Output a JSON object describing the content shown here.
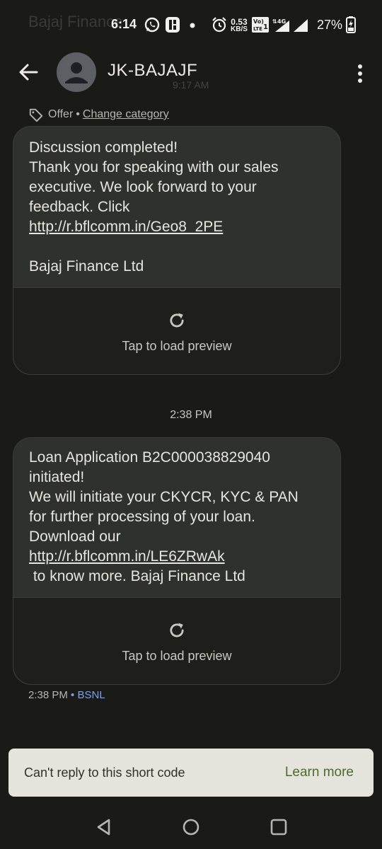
{
  "statusbar": {
    "ghost_title": "Bajaj Finance",
    "time": "6:14",
    "netspeed_value": "0.53",
    "netspeed_unit": "KB/S",
    "network": "4G",
    "battery": "27%"
  },
  "header": {
    "contact_name": "JK-BAJAJF",
    "ghost_time": "9:17 AM"
  },
  "category": {
    "label": "Offer",
    "separator": "•",
    "change_link": "Change category"
  },
  "messages": [
    {
      "line1": "Discussion completed!",
      "line2": "Thank you for speaking with our sales",
      "line3": "executive. We look forward to your",
      "line4": "feedback. Click",
      "link": "http://r.bflcomm.in/Geo8_2PE",
      "signature": "Bajaj Finance Ltd",
      "preview_label": "Tap to load preview"
    },
    {
      "line1": "Loan Application B2C000038829040",
      "line2": "initiated!",
      "line3": "We will initiate your CKYCR, KYC & PAN",
      "line4": "for further processing of your loan.",
      "line5": "Download our",
      "link": "http://r.bflcomm.in/LE6ZRwAk",
      "tail": " to know more. Bajaj Finance Ltd",
      "preview_label": "Tap to load preview"
    }
  ],
  "timestamp_divider": "2:38 PM",
  "meta": {
    "time": "2:38 PM",
    "separator": "•",
    "carrier": "BSNL"
  },
  "snackbar": {
    "message": "Can't reply to this short code",
    "action": "Learn more"
  },
  "colors": {
    "background": "#1a1b17",
    "bubble": "#2f312c",
    "accent_action": "#4c6b2a",
    "carrier_link": "#7aa2f0"
  }
}
